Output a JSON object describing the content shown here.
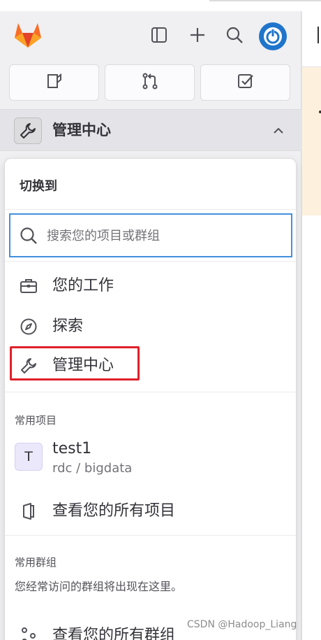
{
  "colors": {
    "accent": "#428fdc",
    "highlight": "#e0202a",
    "brand_orange": "#fc6d26"
  },
  "header": {
    "icons": [
      "gitlab-logo",
      "sidebar-toggle-icon",
      "plus-icon",
      "search-icon",
      "user-avatar"
    ]
  },
  "quick_actions": {
    "icons": [
      "issues-icon",
      "merge-request-icon",
      "todo-icon"
    ]
  },
  "context": {
    "label": "管理中心",
    "icon": "wrench-icon"
  },
  "switcher": {
    "title": "切换到",
    "search_placeholder": "搜索您的项目或群组",
    "items": [
      {
        "label": "您的工作",
        "icon": "briefcase-icon"
      },
      {
        "label": "探索",
        "icon": "compass-icon"
      },
      {
        "label": "管理中心",
        "icon": "wrench-icon"
      }
    ],
    "frequent_projects": {
      "title": "常用项目",
      "project": {
        "avatar_letter": "T",
        "name": "test1",
        "path": "rdc / bigdata"
      },
      "view_all": "查看您的所有项目"
    },
    "frequent_groups": {
      "title": "常用群组",
      "empty": "您经常访问的群组将出现在这里。",
      "view_all": "查看您的所有群组"
    }
  },
  "watermark": "CSDN @Hadoop_Liang"
}
